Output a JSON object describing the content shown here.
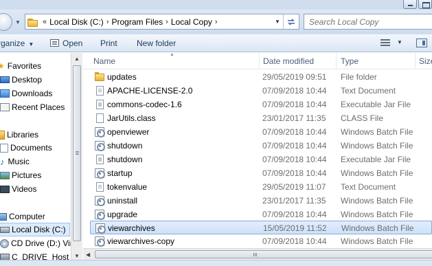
{
  "address_bar": {
    "overflow": "«",
    "segments": [
      "Local Disk (C:)",
      "Program Files",
      "Local Copy"
    ],
    "separator": "›",
    "dropdown": "▼"
  },
  "search": {
    "placeholder": "Search Local Copy"
  },
  "toolbar": {
    "organize": "rganize",
    "open": "Open",
    "print": "Print",
    "new_folder": "New folder"
  },
  "nav": {
    "favorites": "Favorites",
    "desktop": "Desktop",
    "downloads": "Downloads",
    "recent": "Recent Places",
    "libraries": "Libraries",
    "documents": "Documents",
    "music": "Music",
    "pictures": "Pictures",
    "videos": "Videos",
    "computer": "Computer",
    "local_disk": "Local Disk (C:)",
    "cd_drive": "CD Drive (D:) Virt",
    "c_drive_host": "C_DRIVE_Host (\\)"
  },
  "columns": {
    "name": "Name",
    "date": "Date modified",
    "type": "Type",
    "size": "Size"
  },
  "files": [
    {
      "name": "updates",
      "date": "29/05/2019 09:51",
      "type": "File folder",
      "icon": "folder-icon"
    },
    {
      "name": "APACHE-LICENSE-2.0",
      "date": "07/09/2018 10:44",
      "type": "Text Document",
      "icon": "text-document-icon"
    },
    {
      "name": "commons-codec-1.6",
      "date": "07/09/2018 10:44",
      "type": "Executable Jar File",
      "icon": "jar-file-icon"
    },
    {
      "name": "JarUtils.class",
      "date": "23/01/2017 11:35",
      "type": "CLASS File",
      "icon": "class-file-icon"
    },
    {
      "name": "openviewer",
      "date": "07/09/2018 10:44",
      "type": "Windows Batch File",
      "icon": "batch-file-icon"
    },
    {
      "name": "shutdown",
      "date": "07/09/2018 10:44",
      "type": "Windows Batch File",
      "icon": "batch-file-icon"
    },
    {
      "name": "shutdown",
      "date": "07/09/2018 10:44",
      "type": "Executable Jar File",
      "icon": "jar-file-icon"
    },
    {
      "name": "startup",
      "date": "07/09/2018 10:44",
      "type": "Windows Batch File",
      "icon": "batch-file-icon"
    },
    {
      "name": "tokenvalue",
      "date": "29/05/2019 11:07",
      "type": "Text Document",
      "icon": "text-document-icon"
    },
    {
      "name": "uninstall",
      "date": "23/01/2017 11:35",
      "type": "Windows Batch File",
      "icon": "batch-file-icon"
    },
    {
      "name": "upgrade",
      "date": "07/09/2018 10:44",
      "type": "Windows Batch File",
      "icon": "batch-file-icon"
    },
    {
      "name": "viewarchives",
      "date": "15/05/2019 11:52",
      "type": "Windows Batch File",
      "icon": "batch-file-icon",
      "selected": true
    },
    {
      "name": "viewarchives-copy",
      "date": "07/09/2018 10:44",
      "type": "Windows Batch File",
      "icon": "batch-file-icon"
    }
  ],
  "colors": {
    "selection": "#cde1f8",
    "selection_border": "#84acdd",
    "chrome": "#dbe6f4"
  }
}
